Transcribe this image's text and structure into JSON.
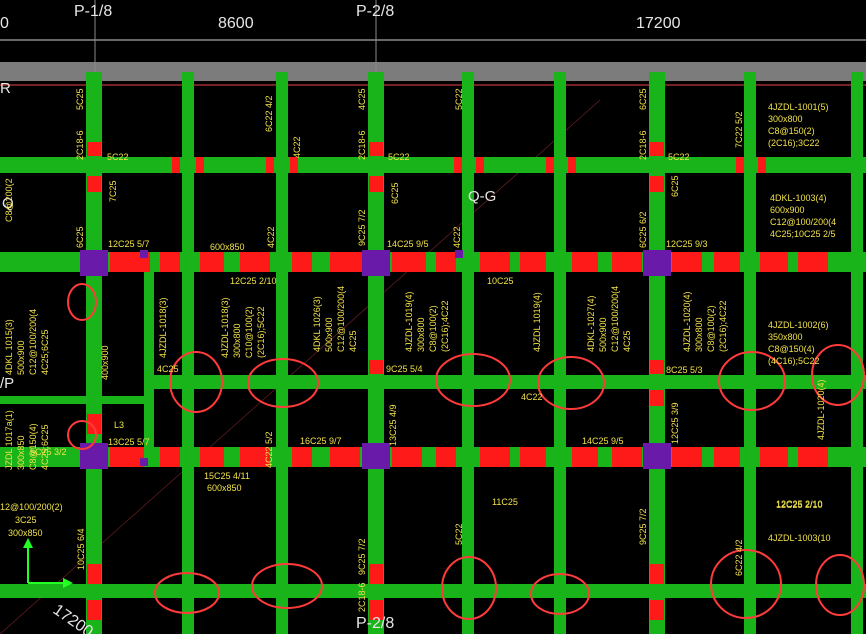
{
  "colors": {
    "background": "#000000",
    "beam": "#19b419",
    "column": "#6a1aa8",
    "rebar_red": "#ff1a1a",
    "annotation": "#f0e14a",
    "axis": "#dddddd",
    "circle": "#ff3b3b",
    "gray_band": "#808080"
  },
  "grid_labels": {
    "p18_top": "P-1/8",
    "p28_top": "P-2/8",
    "p28_bottom": "P-2/8",
    "left_zero": "0",
    "dim_8600": "8600",
    "dim_17200": "17200",
    "dim_17200_bottom": "17200",
    "q": "Q",
    "qg": "Q-G",
    "p_slash": "/P",
    "r": "R"
  },
  "annotations": {
    "a1": "4JZDL-1001(5)",
    "a2": "300x800",
    "a3": "C8@150(2)",
    "a4": "(2C16);3C22",
    "b1": "4DKL-1003(4)",
    "b2": "600x900",
    "b3": "C12@100/200(4",
    "b4": "4C25;10C25 2/5",
    "c1": "4JZDL-1002(6)",
    "c2": "350x800",
    "c3": "C8@150(4)",
    "c4": "(4C16);5C22",
    "d1": "4JZDL-1003(10",
    "e1": "12C25 2/10",
    "f1": "5C22",
    "f2": "5C22",
    "f3": "5C22",
    "g1": "12C25 5/7",
    "g2": "600x850",
    "g3": "14C25 9/5",
    "g4": "12C25 9/3",
    "h1": "12C25 2/10",
    "h2": "10C25",
    "h3": "4C25",
    "h4": "9C25 5/4",
    "h5": "8C25 5/3",
    "h6": "4C22",
    "i1": "13C25 5/7",
    "i2": "16C25 9/7",
    "i3": "14C25 9/5",
    "i4": "15C25 4/11",
    "i5": "600x850",
    "i6": "11C25",
    "i7": "12C25 2/10",
    "j1": "5C25 3/2",
    "j2": "12@100/200(2)",
    "j3": "3C25",
    "j4": "300x850",
    "k1": "L3",
    "k2": "400x900",
    "v1": "4JZDL-1018(3)",
    "v2": "4JZDL-1018(3)",
    "v3": "300x800",
    "v4": "C10@100(2)",
    "v5": "(2C16);5C22",
    "v6": "4DKL 1026(3)",
    "v7": "500x900",
    "v8": "C12@100/200(4",
    "v9": "4C25",
    "v10": "4JZDL-1019(4)",
    "v11": "300x800",
    "v12": "C8@100(2)",
    "v13": "(2C16);4C22",
    "v14": "4JZDL 1019(4)",
    "v15": "4DKL-1027(4)",
    "v16": "500x900",
    "v17": "C12@100/200(4",
    "v18": "4C25",
    "v19": "4JZDL-1020(4)",
    "v20": "300x800",
    "v21": "C8@100(2)",
    "v22": "(2C16);4C22",
    "v23": "4DKL 1015(3)",
    "v24": "500x900",
    "v25": "C12@100/200(4",
    "v26": "4C25;6C25",
    "v27": "JZDL 1017a(1)",
    "v28": "300x850",
    "v29": "C8@150(4)",
    "v30": "4C25;6C25",
    "vc1": "5C25",
    "vc2": "7C25",
    "vc3": "6C25",
    "vc4": "4C25",
    "vc5": "5C22",
    "vc6": "6C22 4/2",
    "vc7": "4C22",
    "vc8": "6C25",
    "vc9": "9C25 7/2",
    "vc10": "6C25",
    "vc11": "4C22",
    "vc12": "4C22",
    "vc13": "13C25 4/9",
    "vc14": "12C25 3/9",
    "vc15": "7C22 5/2",
    "vc16": "6C25 6/2",
    "vc17": "10C25 6/4",
    "vc18": "9C25 7/2",
    "vc19": "5C22",
    "vc20": "9C25 7/2",
    "vc21": "6C22 4/2",
    "vc22": "4C22 5/2",
    "vc23": "4JZDL-1020(4)",
    "vc24": "6C25",
    "vc25": "C8@200(2",
    "vc26": "2C18-6",
    "vc27": "2C18-6",
    "vc28": "2C18-6",
    "vc29": "2C18-6"
  }
}
